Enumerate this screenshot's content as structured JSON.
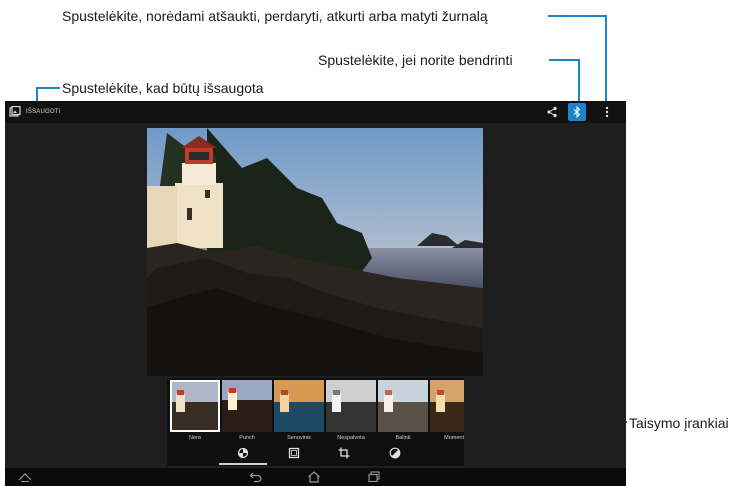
{
  "callouts": {
    "menu": "Spustelėkite, norėdami atšaukti, perdaryti, atkurti arba matyti žurnalą",
    "share": "Spustelėkite, jei norite bendrinti",
    "save": "Spustelėkite, kad būtų išsaugota",
    "tools": "Taisymo įrankiai"
  },
  "actionbar": {
    "save_label": "IŠSAUGOTI",
    "icons": [
      "gallery-icon",
      "share-icon",
      "bluetooth-icon",
      "overflow-menu-icon"
    ]
  },
  "filters": [
    {
      "label": "Nėra",
      "selected": true
    },
    {
      "label": "Punch",
      "selected": false
    },
    {
      "label": "Senovinis",
      "selected": false
    },
    {
      "label": "Nespalvota",
      "selected": false
    },
    {
      "label": "Balinti",
      "selected": false
    },
    {
      "label": "Moment",
      "selected": false
    }
  ],
  "tools": [
    "filters-icon",
    "frame-icon",
    "crop-icon",
    "adjust-icon"
  ],
  "navbar": [
    "hide-nav-icon",
    "back-icon",
    "home-icon",
    "recents-icon"
  ],
  "colors": {
    "accent": "#1a86c8",
    "actionbar": "#111111",
    "screen": "#1e1e1e"
  }
}
